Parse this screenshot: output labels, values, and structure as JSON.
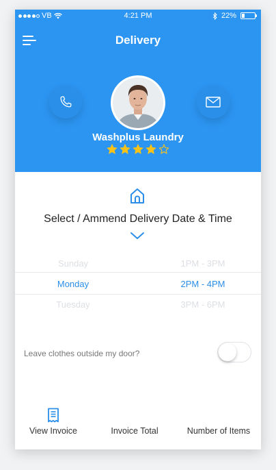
{
  "status_bar": {
    "carrier": "VB",
    "time": "4:21 PM",
    "battery": "22%",
    "battery_level": 0.22,
    "icons": [
      "signal-dots-icon",
      "wifi-icon",
      "bluetooth-icon",
      "battery-icon"
    ]
  },
  "header": {
    "title": "Delivery",
    "menu_icon": "hamburger-menu-icon",
    "call_icon": "phone-icon",
    "mail_icon": "envelope-icon"
  },
  "profile": {
    "name": "Washplus Laundry",
    "rating": 4,
    "rating_max": 5
  },
  "section": {
    "icon": "home-icon",
    "title": "Select / Ammend Delivery Date & Time",
    "expand_icon": "chevron-down-icon"
  },
  "picker": {
    "rows": [
      {
        "day": "Sunday",
        "time": "1PM  -  3PM",
        "state": "faded"
      },
      {
        "day": "Monday",
        "time": "2PM  -  4PM",
        "state": "selected"
      },
      {
        "day": "Tuesday",
        "time": "3PM  -  6PM",
        "state": "faded"
      }
    ]
  },
  "leave_outside": {
    "label": "Leave clothes outside my door?",
    "enabled": false
  },
  "footer": {
    "view_invoice": "View Invoice",
    "invoice_total": "Invoice Total",
    "number_of_items": "Number of Items",
    "invoice_icon": "receipt-icon"
  },
  "colors": {
    "primary": "#2c95f2",
    "accent_text": "#2a8ee8",
    "star": "#f8c219"
  }
}
